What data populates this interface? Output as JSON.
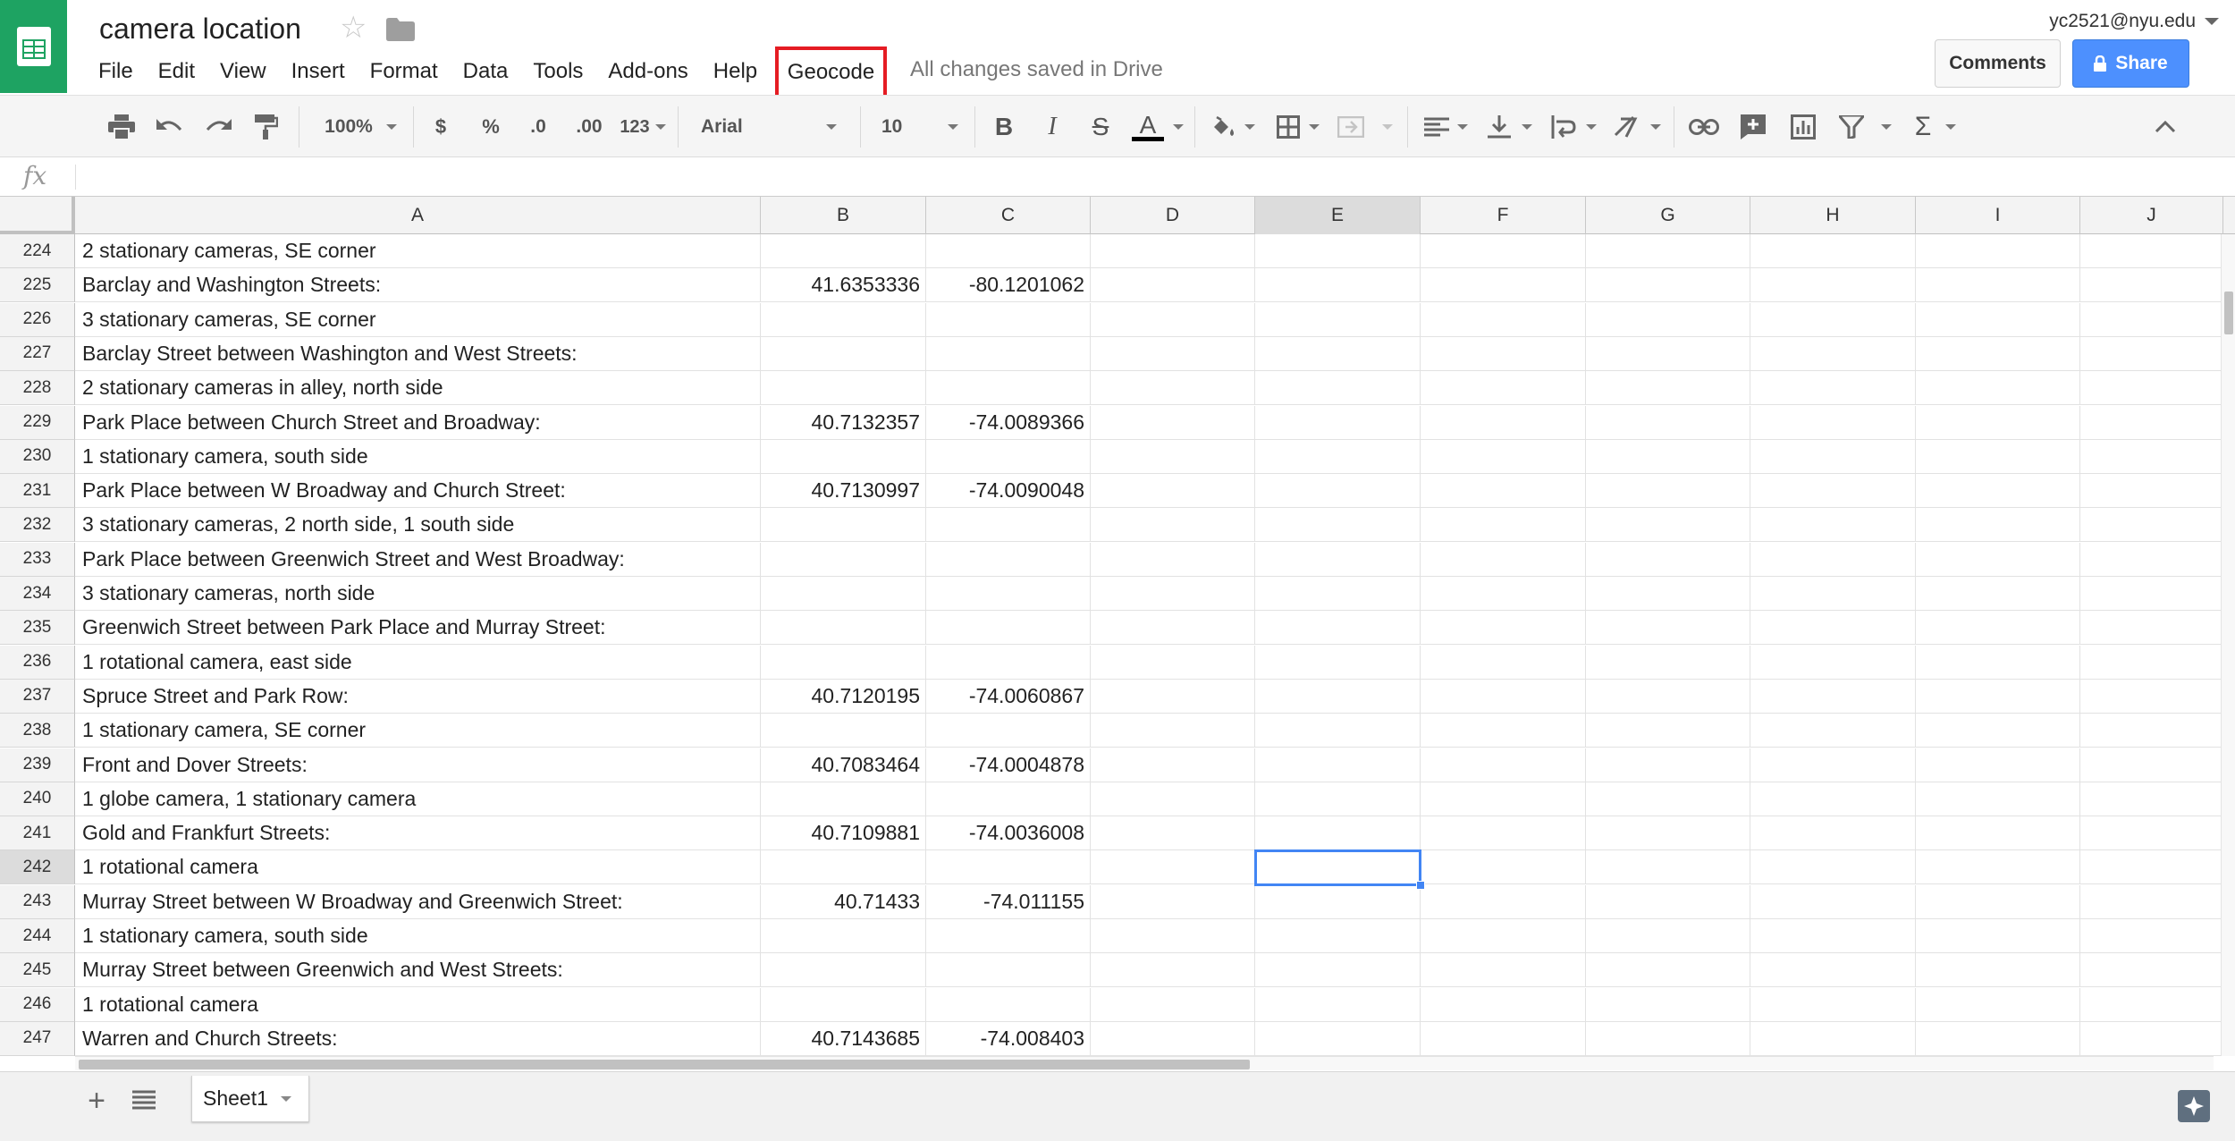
{
  "header": {
    "title": "camera location",
    "account": "yc2521@nyu.edu",
    "comments_label": "Comments",
    "share_label": "Share",
    "saved_status": "All changes saved in Drive",
    "brand_color": "#1ea362",
    "highlight_color": "#e51c23"
  },
  "menu": [
    "File",
    "Edit",
    "View",
    "Insert",
    "Format",
    "Data",
    "Tools",
    "Add-ons",
    "Help",
    "Geocode"
  ],
  "toolbar": {
    "zoom": "100%",
    "currency": "$",
    "percent": "%",
    "dec_decrease": ".0",
    "dec_increase": ".00",
    "more_formats": "123",
    "font": "Arial",
    "font_size": "10",
    "bold": "B",
    "italic": "I",
    "strike": "S",
    "text_color": "A"
  },
  "formula_bar": {
    "fx_label": "fx",
    "content": ""
  },
  "columns": [
    "A",
    "B",
    "C",
    "D",
    "E",
    "F",
    "G",
    "H",
    "I",
    "J"
  ],
  "selected_cell": "E242",
  "rows": [
    {
      "num": "224",
      "a": "2 stationary cameras, SE corner",
      "b": "",
      "c": ""
    },
    {
      "num": "225",
      "a": "Barclay and Washington Streets:",
      "b": "41.6353336",
      "c": "-80.1201062"
    },
    {
      "num": "226",
      "a": "3 stationary cameras, SE corner",
      "b": "",
      "c": ""
    },
    {
      "num": "227",
      "a": "Barclay Street between Washington and West Streets:",
      "b": "",
      "c": ""
    },
    {
      "num": "228",
      "a": "2 stationary cameras in alley, north side",
      "b": "",
      "c": ""
    },
    {
      "num": "229",
      "a": "Park Place between Church Street and Broadway:",
      "b": "40.7132357",
      "c": "-74.0089366"
    },
    {
      "num": "230",
      "a": "1 stationary camera, south side",
      "b": "",
      "c": ""
    },
    {
      "num": "231",
      "a": "Park Place between W Broadway and Church Street:",
      "b": "40.7130997",
      "c": "-74.0090048"
    },
    {
      "num": "232",
      "a": "3 stationary cameras, 2 north side, 1 south side",
      "b": "",
      "c": ""
    },
    {
      "num": "233",
      "a": "Park Place between Greenwich Street and West Broadway:",
      "b": "",
      "c": ""
    },
    {
      "num": "234",
      "a": "3 stationary cameras, north side",
      "b": "",
      "c": ""
    },
    {
      "num": "235",
      "a": "Greenwich Street between Park Place and Murray Street:",
      "b": "",
      "c": ""
    },
    {
      "num": "236",
      "a": "1 rotational camera, east side",
      "b": "",
      "c": ""
    },
    {
      "num": "237",
      "a": "Spruce Street and Park Row:",
      "b": "40.7120195",
      "c": "-74.0060867"
    },
    {
      "num": "238",
      "a": "1 stationary camera, SE corner",
      "b": "",
      "c": ""
    },
    {
      "num": "239",
      "a": "Front and Dover Streets:",
      "b": "40.7083464",
      "c": "-74.0004878"
    },
    {
      "num": "240",
      "a": "1 globe camera, 1 stationary camera",
      "b": "",
      "c": ""
    },
    {
      "num": "241",
      "a": "Gold and Frankfurt Streets:",
      "b": "40.7109881",
      "c": "-74.0036008"
    },
    {
      "num": "242",
      "a": "1 rotational camera",
      "b": "",
      "c": ""
    },
    {
      "num": "243",
      "a": "Murray Street between W Broadway and Greenwich Street:",
      "b": "40.71433",
      "c": "-74.011155"
    },
    {
      "num": "244",
      "a": "1 stationary camera, south side",
      "b": "",
      "c": ""
    },
    {
      "num": "245",
      "a": "Murray Street between Greenwich and West Streets:",
      "b": "",
      "c": ""
    },
    {
      "num": "246",
      "a": "1 rotational camera",
      "b": "",
      "c": ""
    },
    {
      "num": "247",
      "a": "Warren and Church Streets:",
      "b": "40.7143685",
      "c": "-74.008403"
    }
  ],
  "sheet_tabs": [
    {
      "label": "Sheet1",
      "active": true
    }
  ]
}
